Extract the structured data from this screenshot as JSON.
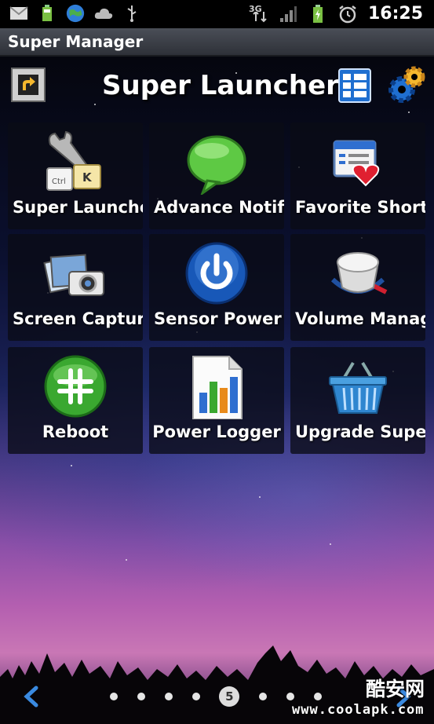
{
  "status_bar": {
    "time": "16:25",
    "network": "3G",
    "left_icons": [
      "gmail-icon",
      "battery-widget-icon",
      "globe-icon",
      "cloud-icon",
      "usb-icon"
    ],
    "right_icons": [
      "network-3g-icon",
      "signal-icon",
      "battery-icon",
      "alarm-icon"
    ]
  },
  "app": {
    "title": "Super Manager"
  },
  "header": {
    "title": "Super Launcher",
    "icons": [
      "back-shortcut-icon",
      "grid-view-icon",
      "settings-gear-icon"
    ]
  },
  "tiles": [
    {
      "label": "Super Launcher",
      "icon": "keyboard-wrench-icon"
    },
    {
      "label": "Advance Notifi",
      "icon": "speech-bubble-icon"
    },
    {
      "label": "Favorite Shorto",
      "icon": "favorite-list-heart-icon"
    },
    {
      "label": "Screen Capture",
      "icon": "camera-photos-icon"
    },
    {
      "label": "Sensor Power C",
      "icon": "power-button-icon"
    },
    {
      "label": "Volume Manag",
      "icon": "volume-knob-icon"
    },
    {
      "label": "Reboot",
      "icon": "reboot-icon"
    },
    {
      "label": "Power Logger",
      "icon": "bar-chart-document-icon"
    },
    {
      "label": "Upgrade Super",
      "icon": "shopping-basket-icon"
    }
  ],
  "pager": {
    "current_page": "5",
    "total_dots": 9
  },
  "watermark": {
    "cn": "酷安网",
    "url": "www.coolapk.com"
  },
  "colors": {
    "title_bar": "#3d4048",
    "tile_bg": "#0a0c16",
    "accent_blue": "#1e6fd6",
    "sky_purple": "#8a4fa8"
  }
}
